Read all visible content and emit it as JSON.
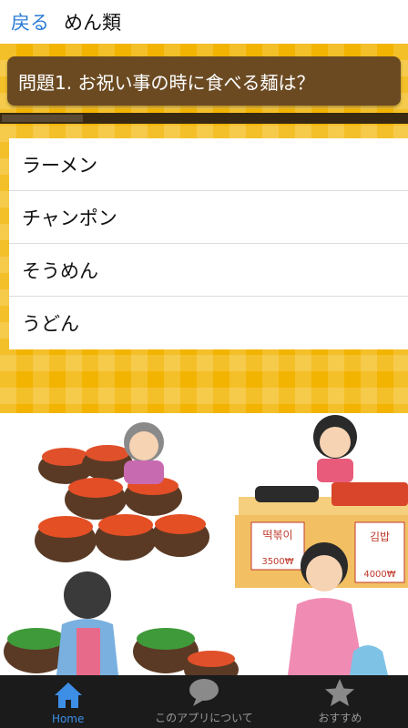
{
  "navbar": {
    "back_label": "戻る",
    "title": "めん類"
  },
  "quiz": {
    "question": "問題1. お祝い事の時に食べる麺は？",
    "progress_fraction": 0.2,
    "answers": [
      "ラーメン",
      "チャンポン",
      "そうめん",
      "うどん"
    ]
  },
  "illustration": {
    "sign_left_title": "떡볶이",
    "sign_left_price": "3500₩",
    "sign_right_title": "김밥",
    "sign_right_price": "4000₩"
  },
  "tabbar": {
    "tabs": [
      {
        "label": "Home",
        "icon": "home-icon",
        "active": true
      },
      {
        "label": "このアプリについて",
        "icon": "speech-bubble-icon",
        "active": false
      },
      {
        "label": "おすすめ",
        "icon": "star-icon",
        "active": false
      }
    ]
  },
  "colors": {
    "accent": "#2a7bd6",
    "question_bg": "#6b4a22",
    "quiz_bg": "#f2b400",
    "tabbar_bg": "#1b1b1b"
  }
}
